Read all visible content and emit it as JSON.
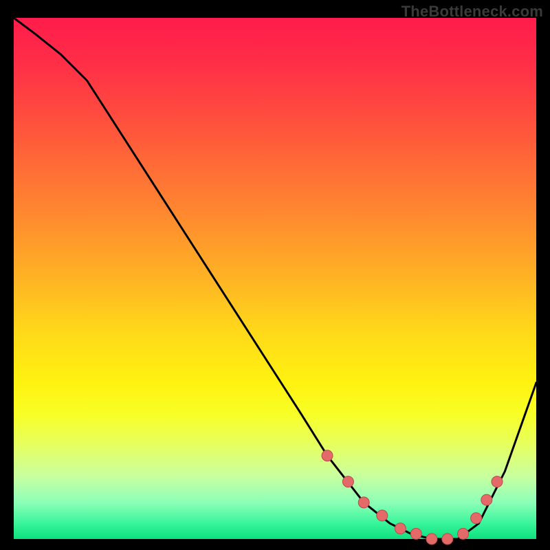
{
  "watermark": "TheBottleneck.com",
  "colors": {
    "frame_bg": "#000000",
    "curve_stroke": "#000000",
    "marker_fill": "#e46a6a",
    "marker_stroke": "#b84a4a",
    "gradient_top": "#ff1c4b",
    "gradient_bottom": "#0ee07f"
  },
  "chart_data": {
    "type": "line",
    "title": "",
    "xlabel": "",
    "ylabel": "",
    "xlim": [
      0,
      100
    ],
    "ylim": [
      0,
      100
    ],
    "grid": false,
    "legend": false,
    "series": [
      {
        "name": "curve",
        "x": [
          0,
          4,
          9,
          14,
          55,
          60,
          67,
          72,
          76,
          80,
          85,
          89,
          91,
          94,
          100
        ],
        "y": [
          100,
          97,
          93,
          88,
          24,
          16,
          7,
          3,
          1,
          0,
          0,
          3,
          7,
          13,
          30
        ]
      }
    ],
    "markers": {
      "name": "highlight-points",
      "x": [
        60,
        64,
        67,
        70.5,
        74,
        77,
        80,
        83,
        86,
        88.5,
        90.5,
        92.5
      ],
      "y": [
        16,
        11,
        7,
        4.5,
        2,
        1,
        0,
        0,
        1,
        4,
        7.5,
        11
      ]
    }
  }
}
